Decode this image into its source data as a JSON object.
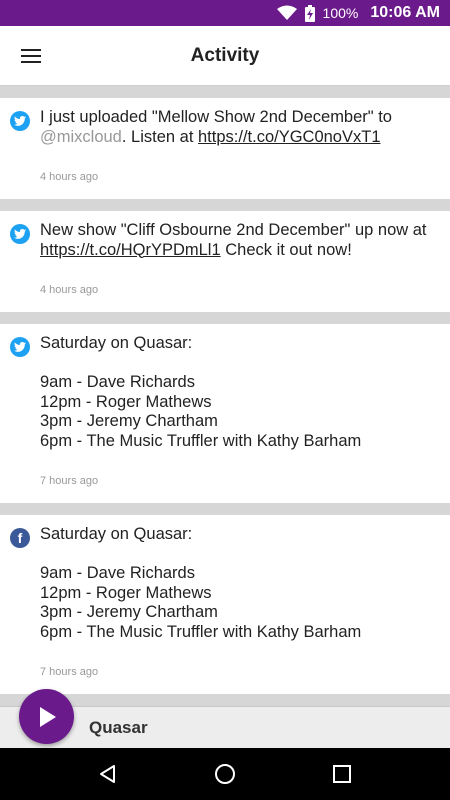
{
  "status_bar": {
    "battery_percent": "100%",
    "time": "10:06 AM",
    "icons": [
      "wifi-icon",
      "battery-charging-icon"
    ]
  },
  "app_bar": {
    "title": "Activity",
    "menu_icon": "hamburger-menu-icon"
  },
  "feed": {
    "posts": [
      {
        "source": "twitter",
        "icon": "twitter-icon",
        "text_before": "I just uploaded \"Mellow Show 2nd December\" to ",
        "mention": "@mixcloud",
        "text_middle": ". Listen at ",
        "link": "https://t.co/YGC0noVxT1",
        "time": "4 hours ago"
      },
      {
        "source": "twitter",
        "icon": "twitter-icon",
        "text_before": "New show \"Cliff Osbourne 2nd December\" up now at ",
        "link": "https://t.co/HQrYPDmLl1",
        "text_after": " Check it out now!",
        "time": "4 hours ago"
      },
      {
        "source": "twitter",
        "icon": "twitter-icon",
        "text": "Saturday on Quasar:\n\n9am - Dave Richards\n12pm - Roger Mathews\n3pm - Jeremy Chartham\n6pm - The Music Truffler with Kathy Barham",
        "time": "7 hours ago"
      },
      {
        "source": "facebook",
        "icon": "facebook-icon",
        "icon_letter": "f",
        "text": "Saturday on Quasar:\n\n9am - Dave Richards\n12pm - Roger Mathews\n3pm - Jeremy Chartham\n6pm - The Music Truffler with Kathy Barham",
        "time": "7 hours ago"
      }
    ]
  },
  "player": {
    "station_name": "Quasar",
    "play_icon": "play-icon"
  },
  "nav_bar": {
    "buttons": [
      "back-icon",
      "home-icon",
      "recents-icon"
    ]
  },
  "colors": {
    "accent": "#6b1a8c",
    "twitter": "#1da1f2",
    "facebook": "#3b5998",
    "separator": "#d6d6d6"
  }
}
